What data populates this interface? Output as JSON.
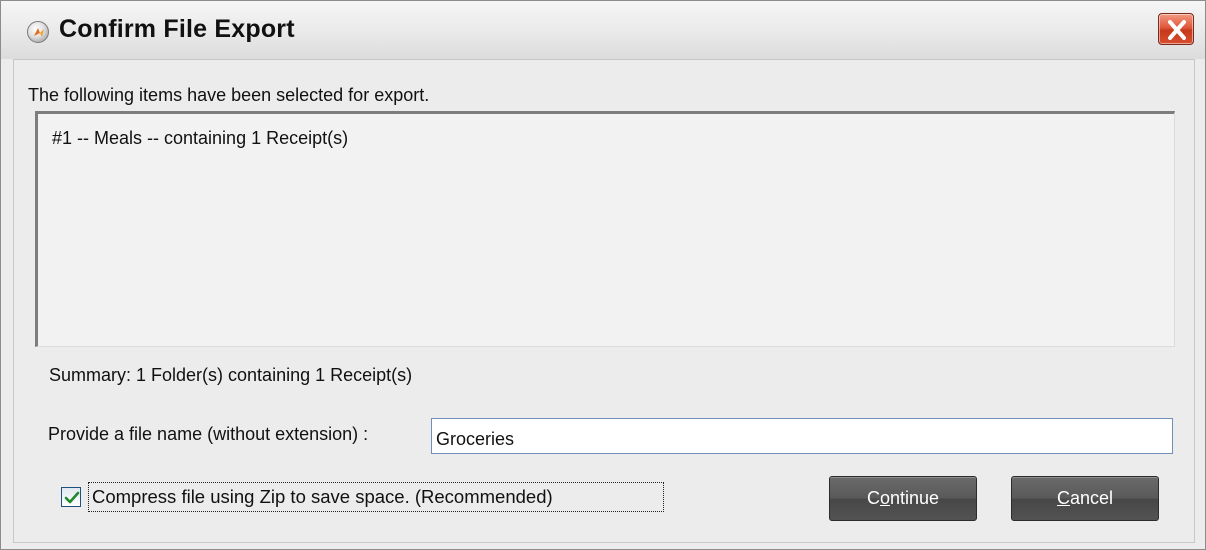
{
  "window": {
    "title": "Confirm File Export",
    "icon": "app-logo-icon",
    "close_icon": "close-icon"
  },
  "intro_text": "The following items have been selected for export.",
  "export_list": {
    "items": [
      "#1 -- Meals -- containing 1 Receipt(s)"
    ]
  },
  "summary_text": "Summary: 1 Folder(s) containing 1 Receipt(s)",
  "filename": {
    "label": "Provide a file name (without extension) :",
    "value": "Groceries"
  },
  "compress": {
    "label": "Compress file using Zip to save space. (Recommended)",
    "checked": true
  },
  "buttons": {
    "continue": {
      "pre": "C",
      "mnemonic": "o",
      "post": "ntinue"
    },
    "cancel": {
      "pre": "",
      "mnemonic": "C",
      "post": "ancel"
    }
  },
  "colors": {
    "close_button": "#d84e30",
    "button_dark": "#555555",
    "input_border": "#6f8fb8"
  }
}
